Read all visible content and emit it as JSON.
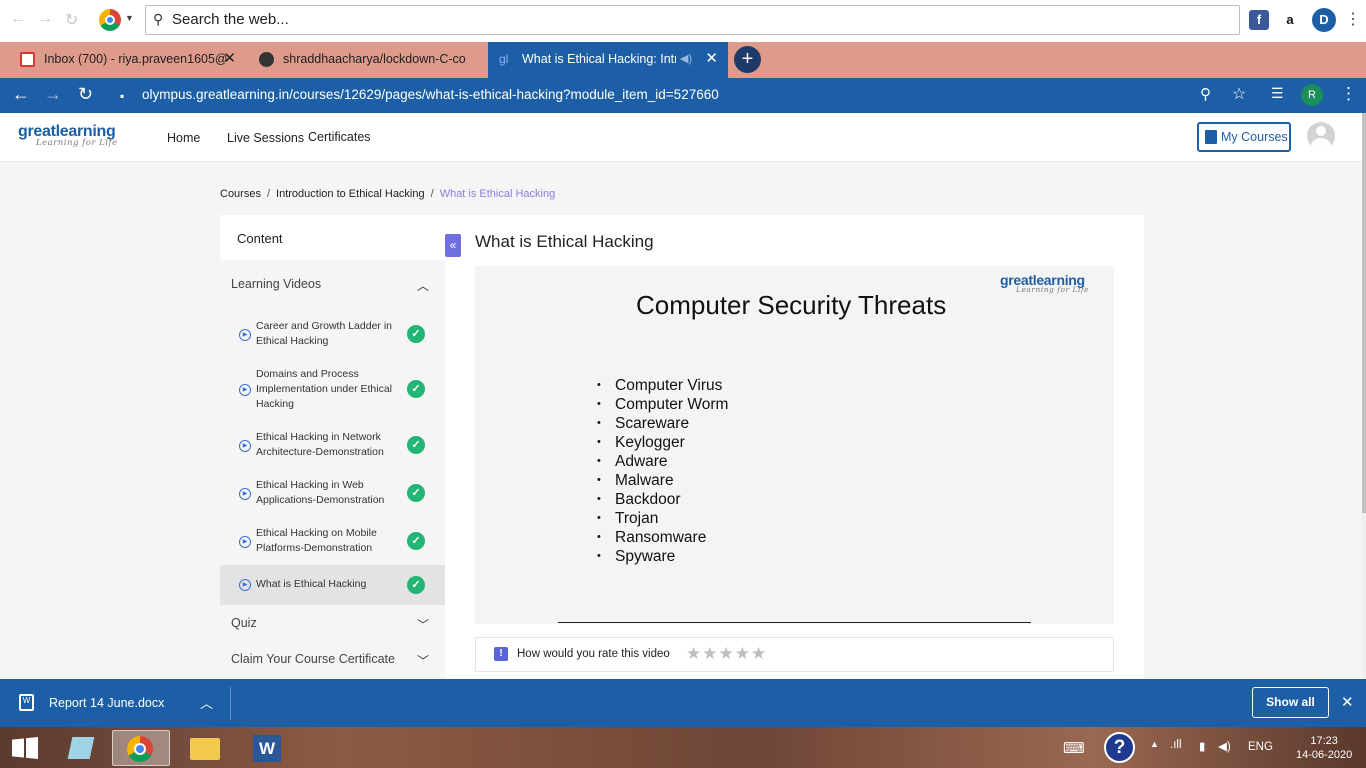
{
  "browser": {
    "search_placeholder": "Search the web...",
    "url": "olympus.greatlearning.in/courses/12629/pages/what-is-ethical-hacking?module_item_id=527660",
    "profile_initial": "R",
    "tabs": [
      {
        "label": "Inbox (700) - riya.praveen1605@",
        "active": false
      },
      {
        "label": "shraddhaacharya/lockdown-C-co",
        "active": false
      },
      {
        "label": "What is Ethical Hacking: Intro",
        "active": true
      }
    ],
    "ext_amazon": "a",
    "ext_d": "D"
  },
  "site": {
    "logo": "greatlearning",
    "logo_tagline": "Learning for Life",
    "nav": [
      "Home",
      "Live Sessions",
      "Certificates"
    ],
    "my_courses": "My Courses"
  },
  "breadcrumb": {
    "items": [
      "Courses",
      "Introduction to Ethical Hacking",
      "What is Ethical Hacking"
    ],
    "sep": "/"
  },
  "sidebar": {
    "content_label": "Content",
    "learning_videos": "Learning Videos",
    "items": [
      "Career and Growth Ladder in Ethical Hacking",
      "Domains and Process Implementation under Ethical Hacking",
      "Ethical Hacking in Network Architecture-Demonstration",
      "Ethical Hacking in Web Applications-Demonstration",
      "Ethical Hacking on Mobile Platforms-Demonstration",
      "What is Ethical Hacking"
    ],
    "quiz": "Quiz",
    "certificate": "Claim Your Course Certificate"
  },
  "video": {
    "title": "What is Ethical Hacking",
    "slide_title": "Computer Security Threats",
    "slide_items": [
      "Computer Virus",
      "Computer Worm",
      "Scareware",
      "Keylogger",
      "Adware",
      "Malware",
      "Backdoor",
      "Trojan",
      "Ransomware",
      "Spyware"
    ],
    "rate_label": "How would you rate this video",
    "rating_stars": 0
  },
  "download_bar": {
    "file": "Report 14 June.docx",
    "show_all": "Show all"
  },
  "taskbar": {
    "lang": "ENG",
    "time": "17:23",
    "date": "14-06-2020"
  }
}
